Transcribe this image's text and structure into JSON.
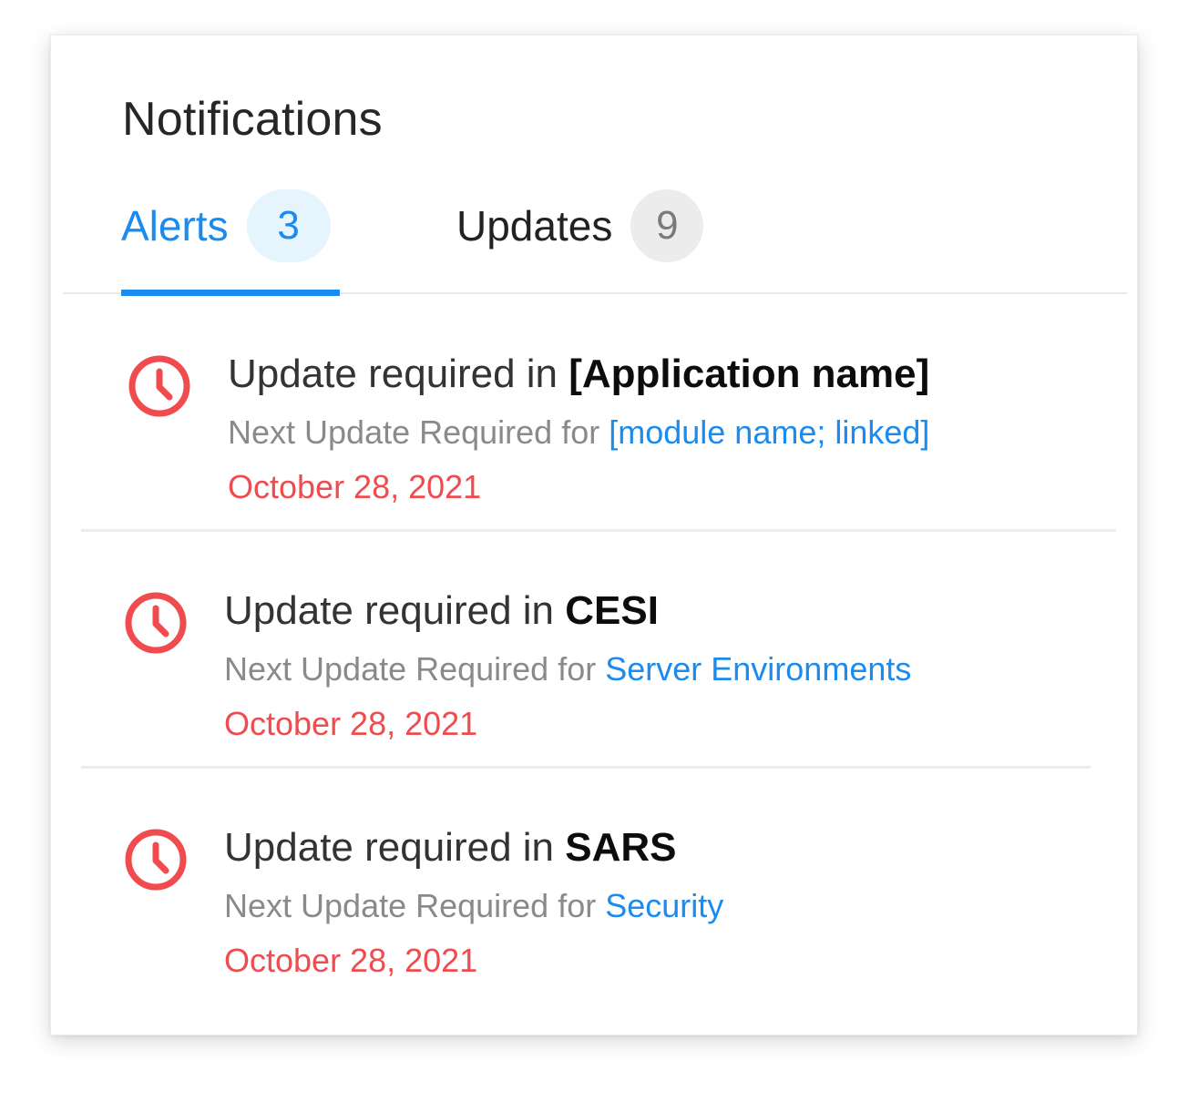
{
  "header": {
    "title": "Notifications"
  },
  "tabs": [
    {
      "label": "Alerts",
      "count": "3",
      "active": true
    },
    {
      "label": "Updates",
      "count": "9",
      "active": false
    }
  ],
  "alerts": [
    {
      "icon": "clock-icon",
      "title_prefix": "Update required in",
      "title_emph": "[Application name]",
      "sub_prefix": "Next Update Required for",
      "sub_link": "[module name; linked]",
      "date": "October 28, 2021"
    },
    {
      "icon": "clock-icon",
      "title_prefix": "Update required in",
      "title_emph": "CESI",
      "sub_prefix": "Next Update Required for",
      "sub_link": "Server Environments",
      "date": "October 28, 2021"
    },
    {
      "icon": "clock-icon",
      "title_prefix": "Update required in",
      "title_emph": "SARS",
      "sub_prefix": "Next Update Required for",
      "sub_link": "Security",
      "date": "October 28, 2021"
    }
  ],
  "colors": {
    "accent": "#1a8cf0",
    "accent_bg": "#e6f4fd",
    "alert": "#f04b4f",
    "muted": "#8a8a8a",
    "badge_bg": "#ececec"
  }
}
